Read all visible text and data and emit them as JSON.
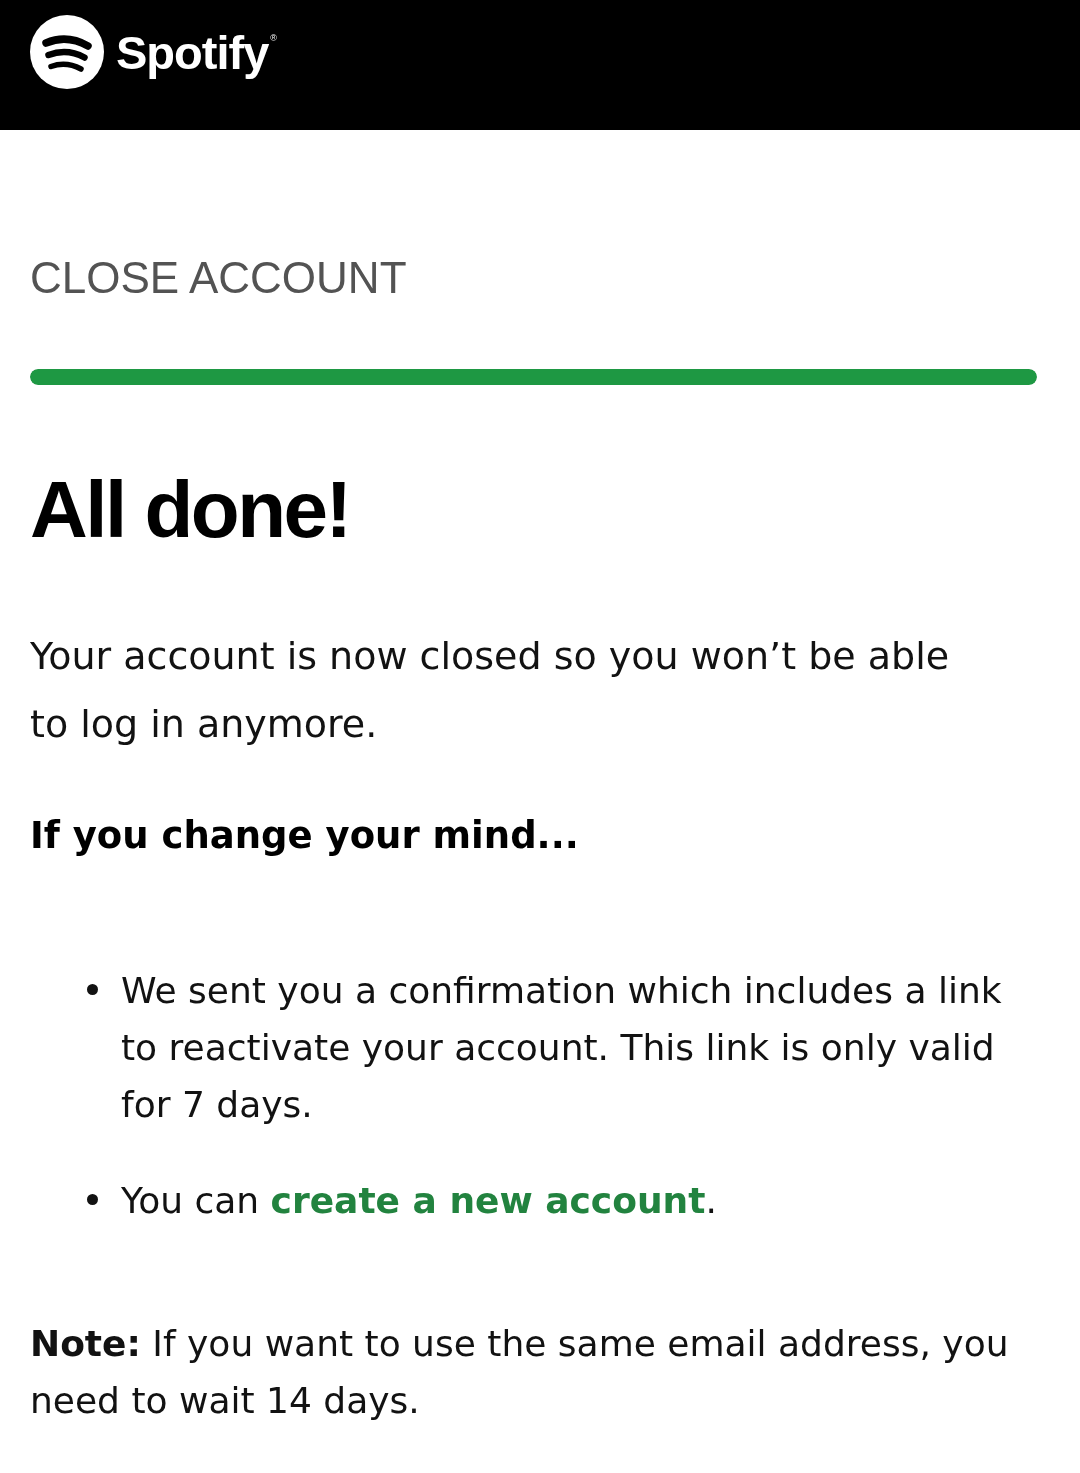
{
  "header": {
    "logo_text": "Spotify$^{®}$"
  },
  "page": {
    "section_title": "CLOSE ACCOUNT",
    "progress": {
      "level": 1
    },
    "heading": "All done!",
    "message": "Your account is now closed so you won’t be able to log in anymore.",
    "subheading": "If you change your mind...",
    "bullets": [
      {
        "parts": [
          {
            "kind": "text",
            "text": "We sent you a confirmation which includes a link to reactivate your account. This link is only valid for 7 days."
          }
        ]
      },
      {
        "parts": [
          {
            "kind": "text",
            "text": "You can "
          },
          {
            "kind": "link",
            "text": "create a new account"
          },
          {
            "kind": "text",
            "text": "."
          }
        ]
      }
    ],
    "note": "**Note:** If you want to use the same email address, you need to wait 14 days."
  }
}
